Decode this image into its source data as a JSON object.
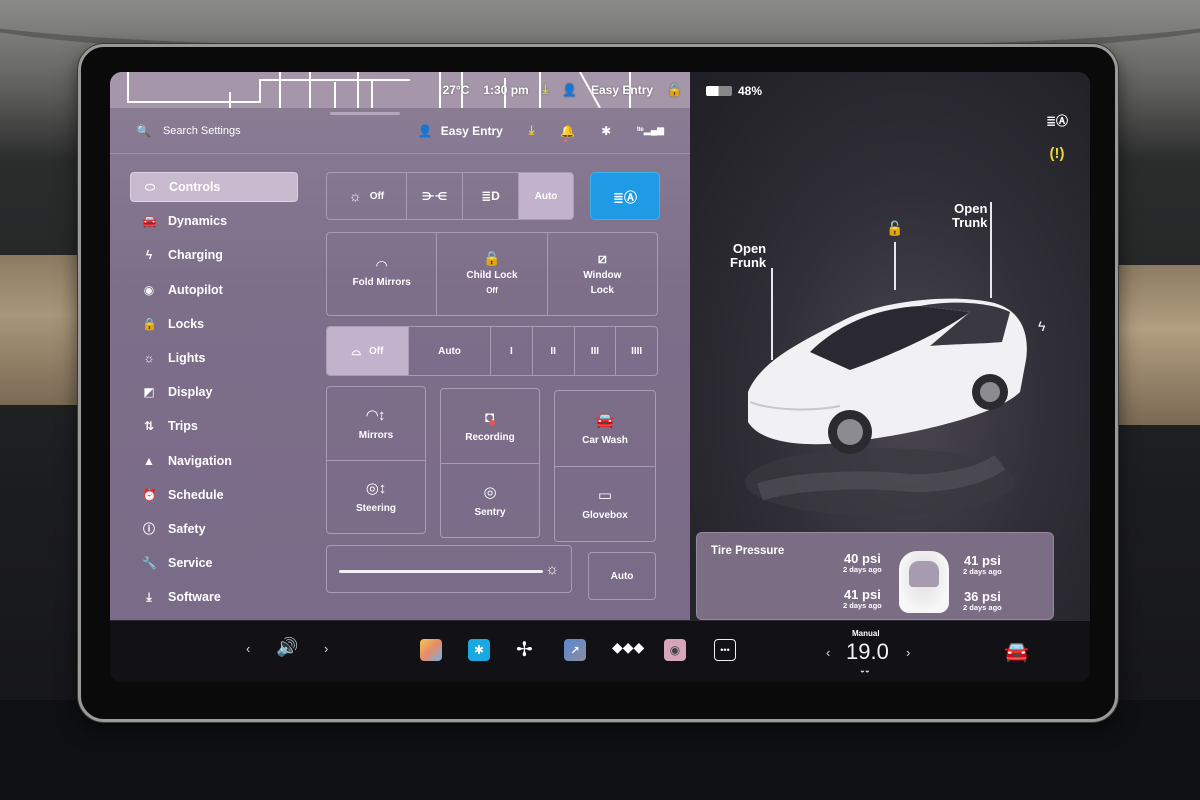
{
  "status_bar": {
    "temperature": "27°C",
    "time": "1:30 pm",
    "profile": "Easy Entry",
    "battery_percent": "48%",
    "battery_level": 0.48
  },
  "settings_header": {
    "search_placeholder": "Search Settings",
    "profile_name": "Easy Entry",
    "icons": [
      "download-icon",
      "bell-icon",
      "bluetooth-icon",
      "lte-signal-icon"
    ]
  },
  "sidebar": {
    "items": [
      {
        "label": "Controls",
        "icon": "toggle-icon",
        "glyph": "⬭",
        "active": true
      },
      {
        "label": "Dynamics",
        "icon": "car-icon",
        "glyph": "🚘",
        "active": false
      },
      {
        "label": "Charging",
        "icon": "bolt-icon",
        "glyph": "ϟ",
        "active": false
      },
      {
        "label": "Autopilot",
        "icon": "steering-wheel-icon",
        "glyph": "◉",
        "active": false
      },
      {
        "label": "Locks",
        "icon": "lock-icon",
        "glyph": "🔒",
        "active": false
      },
      {
        "label": "Lights",
        "icon": "sun-icon",
        "glyph": "☼",
        "active": false
      },
      {
        "label": "Display",
        "icon": "display-icon",
        "glyph": "◩",
        "active": false
      },
      {
        "label": "Trips",
        "icon": "trips-icon",
        "glyph": "⇅",
        "active": false
      },
      {
        "label": "Navigation",
        "icon": "navigation-icon",
        "glyph": "▲",
        "active": false
      },
      {
        "label": "Schedule",
        "icon": "alarm-clock-icon",
        "glyph": "⏰",
        "active": false
      },
      {
        "label": "Safety",
        "icon": "safety-icon",
        "glyph": "ⓘ",
        "active": false
      },
      {
        "label": "Service",
        "icon": "wrench-icon",
        "glyph": "🔧",
        "active": false
      },
      {
        "label": "Software",
        "icon": "download-icon",
        "glyph": "⤓",
        "active": false
      }
    ]
  },
  "controls": {
    "headlights": {
      "options": [
        {
          "label": "Off",
          "icon": "sun-icon",
          "selected": false
        },
        {
          "label": "",
          "icon": "parking-lights-icon",
          "selected": false
        },
        {
          "label": "",
          "icon": "low-beam-icon",
          "selected": false
        },
        {
          "label": "Auto",
          "icon": "",
          "selected": true
        }
      ],
      "auto_high_beam": {
        "icon": "auto-high-beam-icon",
        "active": true,
        "color": "#1f9be6"
      }
    },
    "quick": [
      {
        "label": "Fold Mirrors",
        "sub": "",
        "icon": "mirror-icon"
      },
      {
        "label": "Child Lock",
        "sub": "Off",
        "icon": "child-lock-icon"
      },
      {
        "label": "Window",
        "sub": "Lock",
        "icon": "window-lock-icon"
      }
    ],
    "wipers": {
      "options": [
        {
          "label": "Off",
          "selected": true
        },
        {
          "label": "Auto",
          "selected": false
        },
        {
          "label": "I",
          "selected": false
        },
        {
          "label": "II",
          "selected": false
        },
        {
          "label": "III",
          "selected": false
        },
        {
          "label": "IIII",
          "selected": false
        }
      ]
    },
    "tiles": [
      {
        "label": "Mirrors",
        "icon": "mirror-adjust-icon"
      },
      {
        "label": "Steering",
        "icon": "steering-adjust-icon"
      },
      {
        "label": "Recording",
        "icon": "dashcam-icon"
      },
      {
        "label": "Sentry",
        "icon": "sentry-icon"
      },
      {
        "label": "Car Wash",
        "icon": "car-wash-icon"
      },
      {
        "label": "Glovebox",
        "icon": "glovebox-icon"
      }
    ],
    "brightness": {
      "level": 1.0,
      "auto_label": "Auto"
    }
  },
  "car_view": {
    "open_frunk": "Open\nFrunk",
    "open_frunk_l1": "Open",
    "open_frunk_l2": "Frunk",
    "open_trunk_l1": "Open",
    "open_trunk_l2": "Trunk",
    "lock_state": "unlocked",
    "indicators": [
      "auto-high-beam-indicator",
      "tpms-warning-indicator"
    ],
    "tpms_color": "#e8d53a"
  },
  "tire_pressure": {
    "title": "Tire Pressure",
    "front_left": {
      "value": "40 psi",
      "updated": "2 days ago"
    },
    "front_right": {
      "value": "41 psi",
      "updated": "2 days ago"
    },
    "rear_left": {
      "value": "41 psi",
      "updated": "2 days ago"
    },
    "rear_right": {
      "value": "36 psi",
      "updated": "2 days ago"
    }
  },
  "dock": {
    "volume_prev": "‹",
    "volume_next": "›",
    "apps": [
      "toybox-icon",
      "bluetooth-app-icon",
      "fan-icon",
      "navigation-app-icon",
      "tidal-icon",
      "camera-icon",
      "more-icon"
    ],
    "climate_mode": "Manual",
    "temperature": "19.0",
    "temp_prev": "‹",
    "temp_next": "›"
  }
}
